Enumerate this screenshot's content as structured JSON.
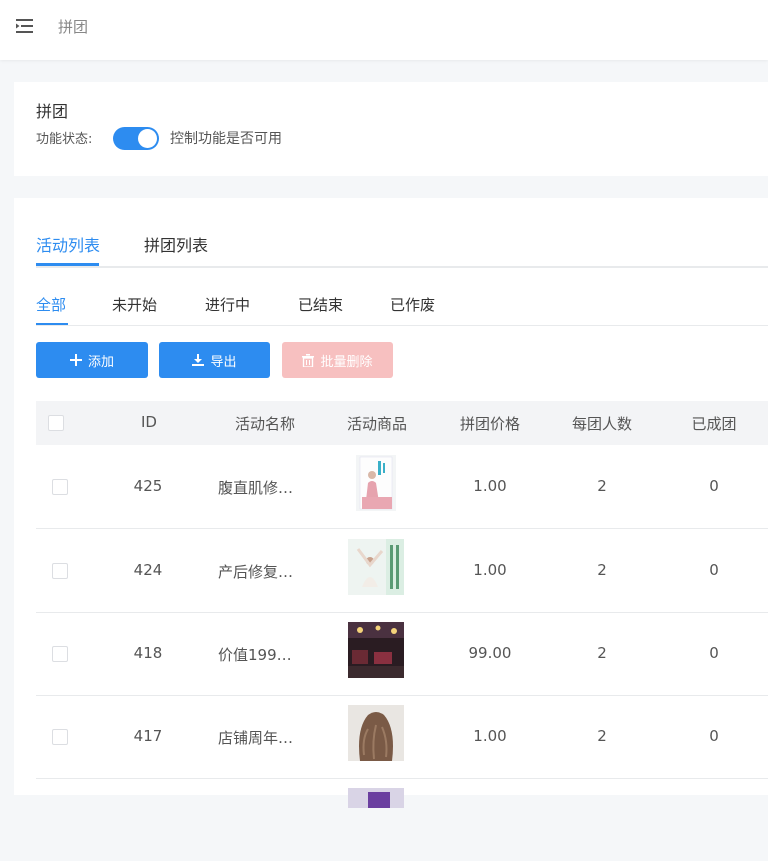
{
  "header": {
    "title": "拼团",
    "menu_icon": "menu-fold-icon"
  },
  "status_card": {
    "title": "拼团",
    "state_label": "功能状态:",
    "switch_on": true,
    "state_desc": "控制功能是否可用"
  },
  "tabs": [
    {
      "label": "活动列表",
      "active": true
    },
    {
      "label": "拼团列表",
      "active": false
    }
  ],
  "subtabs": [
    {
      "label": "全部",
      "active": true
    },
    {
      "label": "未开始",
      "active": false
    },
    {
      "label": "进行中",
      "active": false
    },
    {
      "label": "已结束",
      "active": false
    },
    {
      "label": "已作废",
      "active": false
    }
  ],
  "toolbar": {
    "add_label": "添加",
    "export_label": "导出",
    "batch_delete_label": "批量删除"
  },
  "colors": {
    "primary": "#2d8cf0",
    "danger_disabled": "#f7c0c0"
  },
  "table": {
    "columns": [
      "ID",
      "活动名称",
      "活动商品",
      "拼团价格",
      "每团人数",
      "已成团"
    ],
    "rows": [
      {
        "id": "425",
        "name": "腹直肌修…",
        "image": "book-cover-pink",
        "price": "1.00",
        "members": "2",
        "formed": "0"
      },
      {
        "id": "424",
        "name": "产后修复…",
        "image": "yoga-poster",
        "price": "1.00",
        "members": "2",
        "formed": "0"
      },
      {
        "id": "418",
        "name": "价值199…",
        "image": "salon-interior",
        "price": "99.00",
        "members": "2",
        "formed": "0"
      },
      {
        "id": "417",
        "name": "店铺周年…",
        "image": "curly-hair",
        "price": "1.00",
        "members": "2",
        "formed": "0"
      }
    ]
  }
}
